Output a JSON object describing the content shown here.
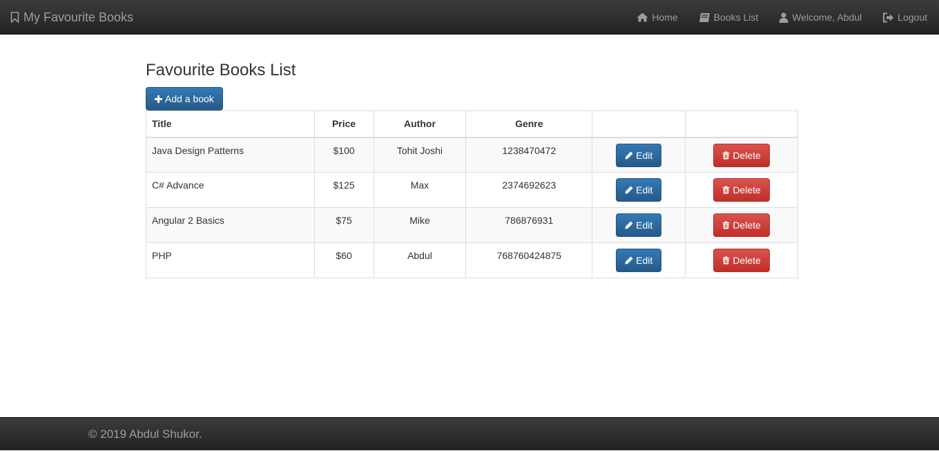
{
  "navbar": {
    "brand": "My Favourite Books",
    "brand_icon": "bookmark-icon",
    "items": [
      {
        "label": "Home",
        "icon": "home-icon"
      },
      {
        "label": "Books List",
        "icon": "book-icon"
      },
      {
        "label": "Welcome, Abdul",
        "icon": "user-icon"
      },
      {
        "label": "Logout",
        "icon": "logout-icon"
      }
    ]
  },
  "main": {
    "title": "Favourite Books List",
    "add_button_label": "Add a book",
    "table": {
      "headers": [
        "Title",
        "Price",
        "Author",
        "Genre",
        "",
        ""
      ],
      "rows": [
        {
          "title": "Java Design Patterns",
          "price": "$100",
          "author": "Tohit Joshi",
          "genre": "1238470472"
        },
        {
          "title": "C# Advance",
          "price": "$125",
          "author": "Max",
          "genre": "2374692623"
        },
        {
          "title": "Angular 2 Basics",
          "price": "$75",
          "author": "Mike",
          "genre": "786876931"
        },
        {
          "title": "PHP",
          "price": "$60",
          "author": "Abdul",
          "genre": "768760424875"
        }
      ],
      "edit_label": "Edit",
      "delete_label": "Delete"
    }
  },
  "footer": {
    "text": "© 2019 Abdul Shukor."
  },
  "colors": {
    "navbar_bg": "#222222",
    "nav_text": "#9d9d9d",
    "primary": "#337ab7",
    "danger": "#d9534f"
  }
}
